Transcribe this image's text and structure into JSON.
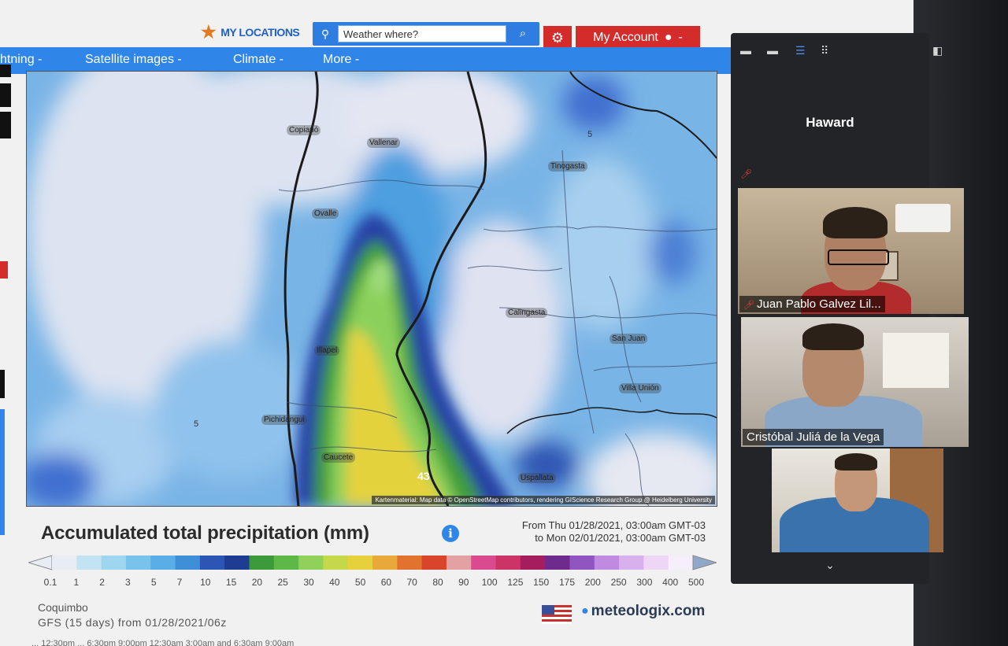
{
  "header": {
    "my_locations": "MY LOCATIONS",
    "search_placeholder": "Weather where?",
    "account_label": "My Account"
  },
  "nav": {
    "items": [
      "htning -",
      "Satellite images -",
      "Climate -",
      "More -"
    ]
  },
  "map": {
    "cities": [
      "Copiapó",
      "Vallenar",
      "Ovalle",
      "Illapel",
      "Pichidangui",
      "Calingasta",
      "San Juan",
      "Villa Unión",
      "Caucete",
      "Uspallata",
      "Tinogasta",
      "Coquimbo"
    ],
    "numbers": [
      "5",
      "5",
      "43"
    ],
    "credit": "Kartenmaterial: Map data © OpenStreetMap contributors, rendering GIScience Research Group @ Heidelberg University"
  },
  "legend": {
    "title": "Accumulated total precipitation (mm)",
    "date_from": "From Thu 01/28/2021, 03:00am GMT-03",
    "date_to": "to Mon 02/01/2021, 03:00am GMT-03",
    "ticks": [
      "0.1",
      "1",
      "2",
      "3",
      "5",
      "7",
      "10",
      "15",
      "20",
      "25",
      "30",
      "40",
      "50",
      "60",
      "70",
      "80",
      "90",
      "100",
      "125",
      "150",
      "175",
      "200",
      "250",
      "300",
      "400",
      "500"
    ],
    "colors": [
      "#e8ecf4",
      "#c2e4f2",
      "#9fd6ef",
      "#78c3ec",
      "#59aee6",
      "#3f8fd8",
      "#2d56b4",
      "#1e3c92",
      "#3d9a3a",
      "#5db848",
      "#8fd15a",
      "#c4d84a",
      "#e6d13c",
      "#e8a83a",
      "#e2732e",
      "#d8452a",
      "#e3a2a2",
      "#d94a8e",
      "#cc3366",
      "#a51d5c",
      "#6e2a8c",
      "#9155c0",
      "#c08ae0",
      "#d8b0ee",
      "#eed6f6",
      "#f7eefb"
    ],
    "place": "Coquimbo",
    "model": "GFS  (15 days)  from 01/28/2021/06z",
    "footer_cut": "... 12:30pm ... 6:30pm 9:00pm 12:30am 3:00am and 6:30am 9:00am"
  },
  "brand": {
    "name": "meteologix.com"
  },
  "zoom": {
    "active_speaker": "Haward",
    "participants": [
      {
        "name": "Juan Pablo Galvez Lil..."
      },
      {
        "name": "Cristóbal Juliá de la Vega"
      },
      {
        "name": ""
      }
    ]
  }
}
